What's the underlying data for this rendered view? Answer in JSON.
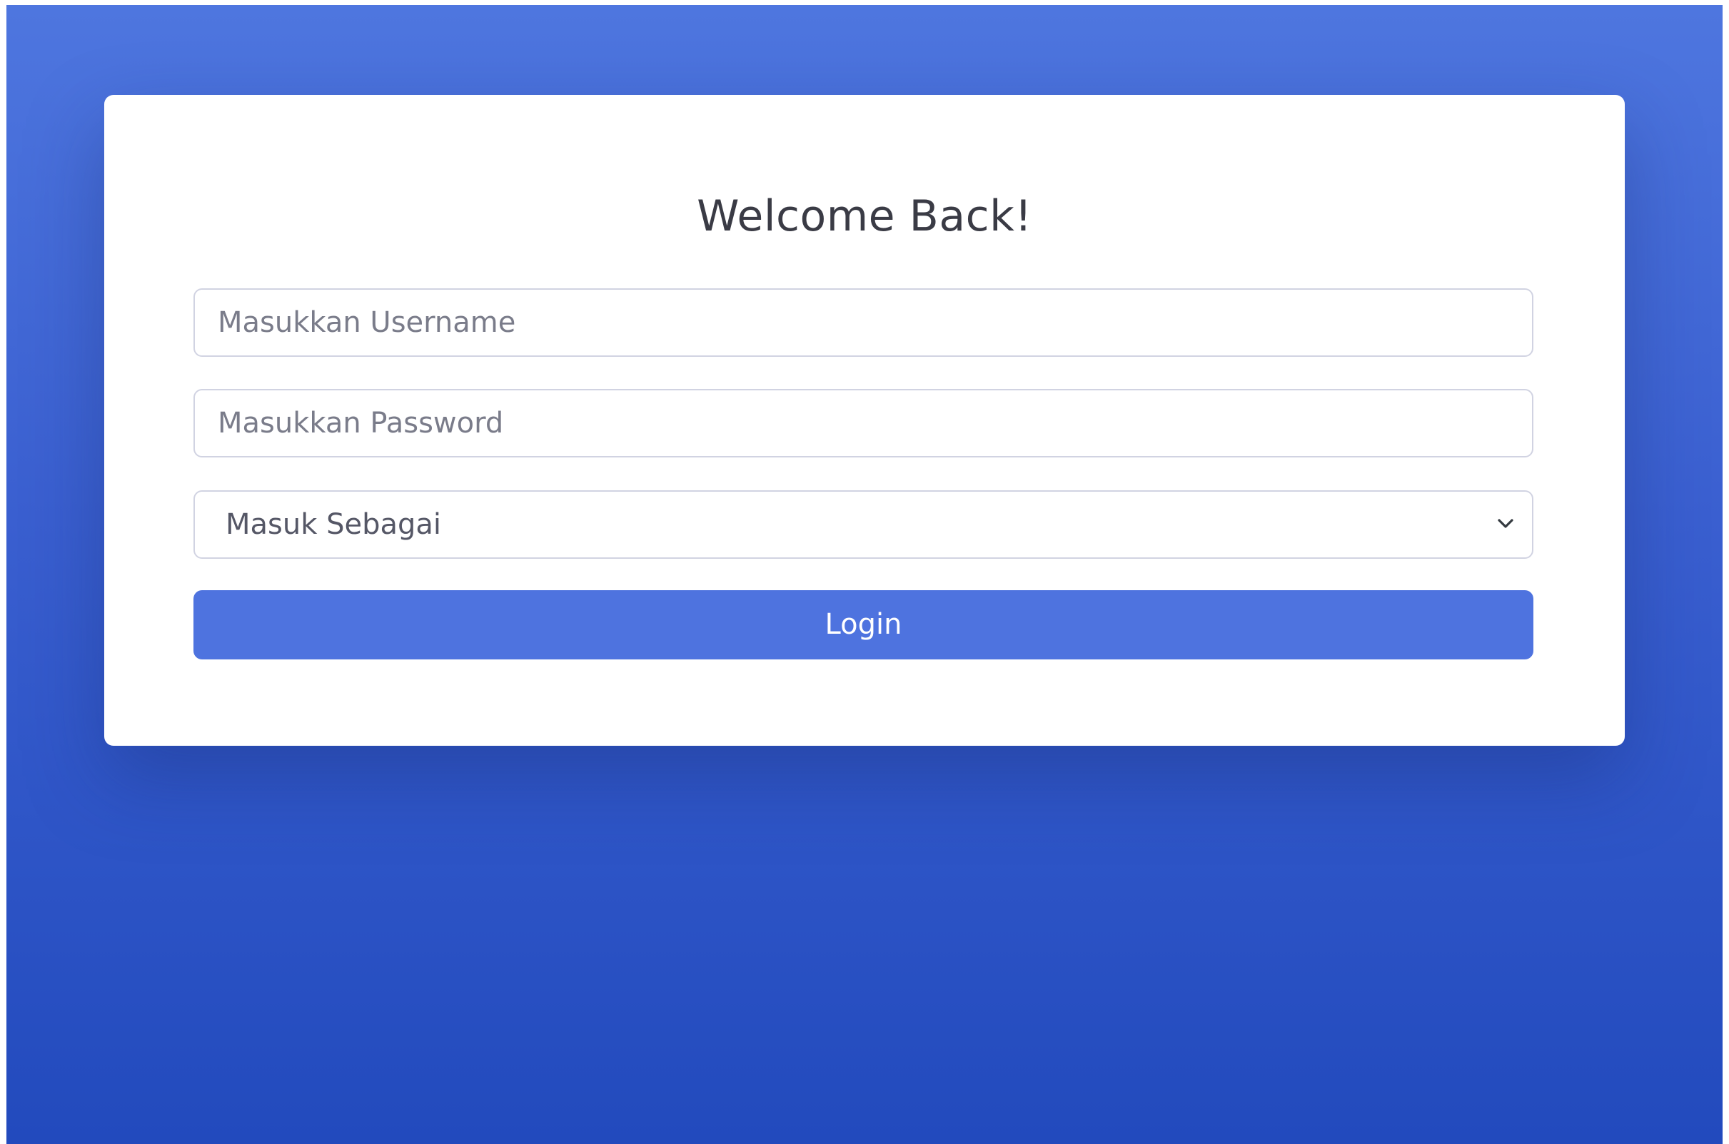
{
  "login": {
    "title": "Welcome Back!",
    "username_placeholder": "Masukkan Username",
    "password_placeholder": "Masukkan Password",
    "role_select": {
      "selected": "Masuk Sebagai"
    },
    "submit_label": "Login"
  },
  "icons": {
    "select_arrow": "chevron-down-icon"
  },
  "colors": {
    "background_top": "#4e76df",
    "background_bottom": "#224abd",
    "primary_button": "#4e73df",
    "title_text": "#3a3b45",
    "input_border": "#d1d3e2"
  }
}
